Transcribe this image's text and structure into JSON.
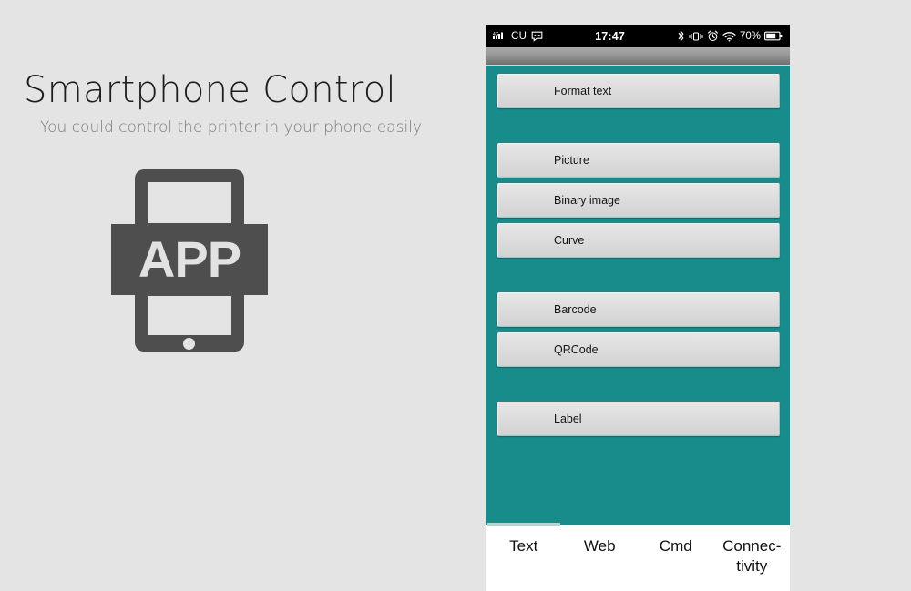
{
  "promo": {
    "title": "Smartphone Control",
    "subtitle": "You could control the printer in your phone easily",
    "icon_label": "APP",
    "icon_name": "app-device-icon"
  },
  "phone": {
    "statusbar": {
      "signal_icon": "signal-4g-icon",
      "carrier": "CU",
      "message_icon": "message-bubble-icon",
      "time": "17:47",
      "bluetooth_icon": "bluetooth-icon",
      "vibrate_icon": "vibrate-icon",
      "alarm_icon": "alarm-clock-icon",
      "wifi_icon": "wifi-icon",
      "battery_percent": "70%",
      "battery_icon": "battery-icon"
    },
    "buttons": [
      {
        "label": "Format text",
        "group_end": true
      },
      {
        "label": "Picture",
        "group_end": false
      },
      {
        "label": "Binary image",
        "group_end": false
      },
      {
        "label": "Curve",
        "group_end": true
      },
      {
        "label": "Barcode",
        "group_end": false
      },
      {
        "label": "QRCode",
        "group_end": true
      },
      {
        "label": "Label",
        "group_end": false
      }
    ],
    "tabs": [
      {
        "label": "Text",
        "active": true
      },
      {
        "label": "Web",
        "active": false
      },
      {
        "label": "Cmd",
        "active": false
      },
      {
        "label": "Connec-tivity",
        "active": false
      }
    ]
  },
  "colors": {
    "page_background": "#e4e4e4",
    "phone_accent": "#188b8b",
    "tab_indicator": "#b4d3d3",
    "icon_gray": "#4e4e4e"
  }
}
